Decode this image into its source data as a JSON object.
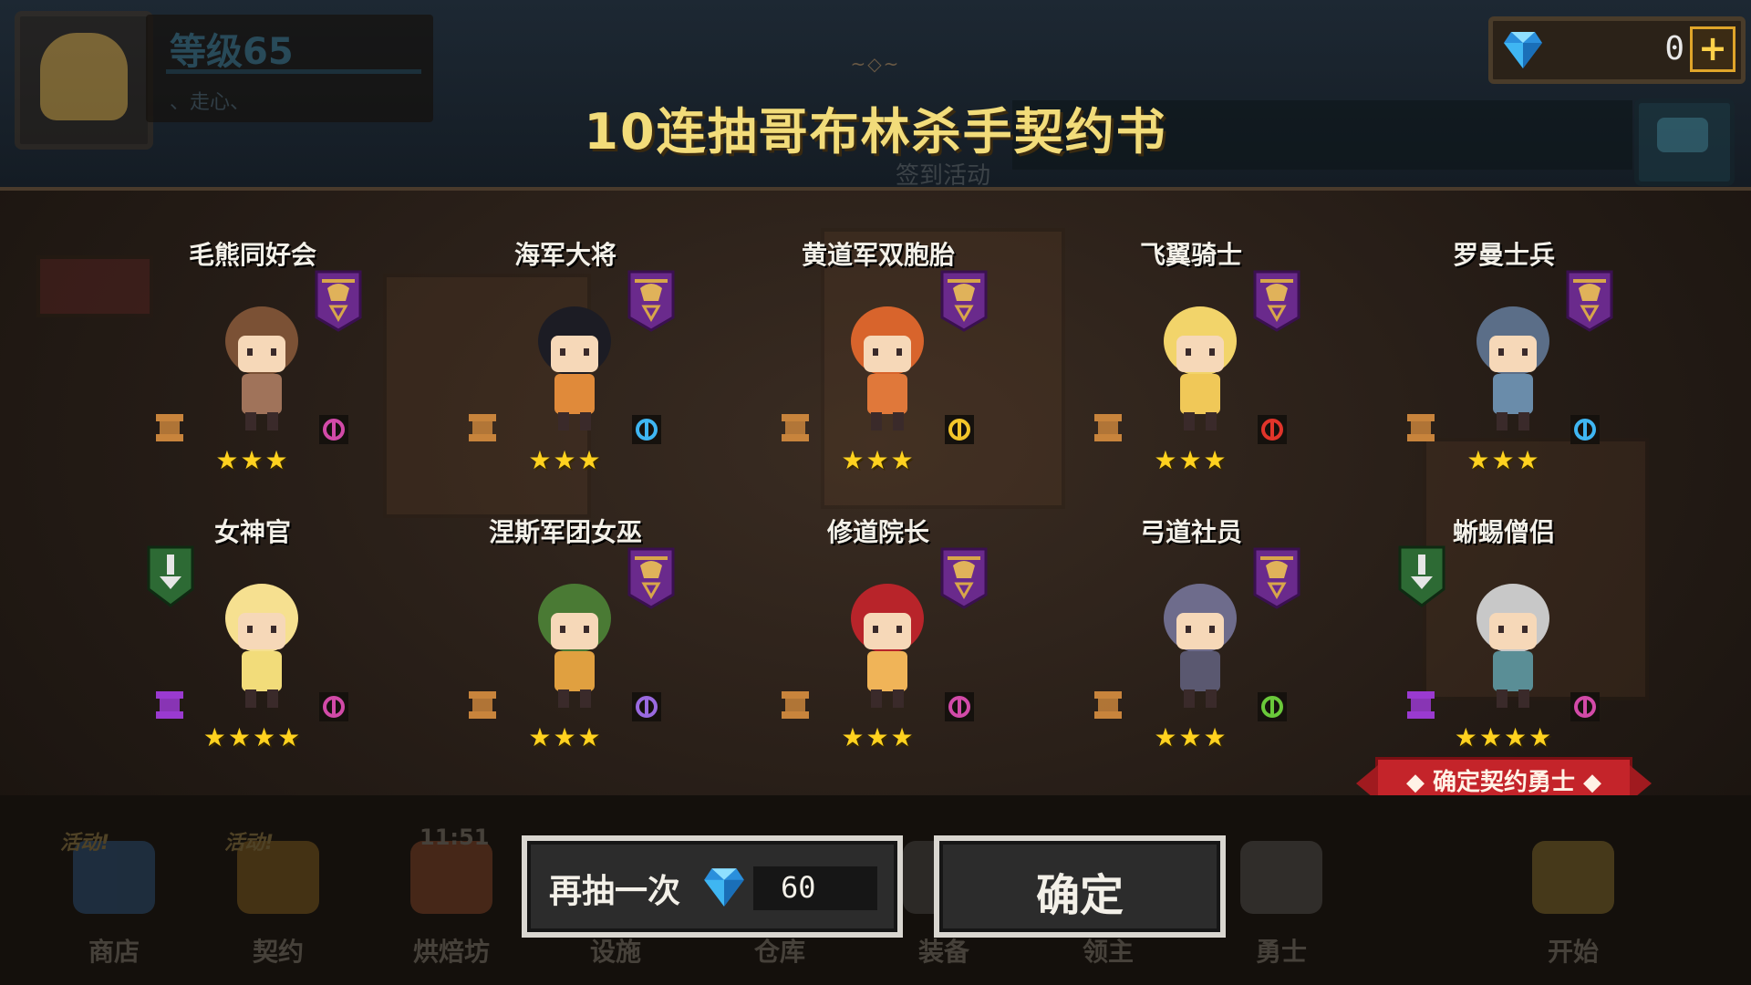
{
  "header": {
    "level": "等级65",
    "level_sub": "、走心、",
    "gems": "0",
    "plus": "+",
    "title_deco": "~◇~",
    "title": "10连抽哥布林杀手契约书",
    "event_ghost": "签到活动"
  },
  "cards": [
    {
      "name": "毛熊同好会",
      "stars": "★★★",
      "rarity": "bronze",
      "class_icon": "cleric-icon",
      "char_color": "#a0735a",
      "hair": "#7b5135"
    },
    {
      "name": "海军大将",
      "stars": "★★★",
      "rarity": "bronze",
      "class_icon": "gem-class-icon",
      "char_color": "#e08a3a",
      "hair": "#1c1c24"
    },
    {
      "name": "黄道军双胞胎",
      "stars": "★★★",
      "rarity": "bronze",
      "class_icon": "sword-icon",
      "char_color": "#e0783a",
      "hair": "#d8642c"
    },
    {
      "name": "飞翼骑士",
      "stars": "★★★",
      "rarity": "bronze",
      "class_icon": "crossed-swords-icon",
      "char_color": "#f0c858",
      "hair": "#f2d46a"
    },
    {
      "name": "罗曼士兵",
      "stars": "★★★",
      "rarity": "bronze",
      "class_icon": "gem-class-icon",
      "char_color": "#6a8caa",
      "hair": "#5b6e88"
    },
    {
      "name": "女神官",
      "stars": "★★★★",
      "rarity": "purple",
      "class_icon": "cleric-icon",
      "char_color": "#f2dc7a",
      "hair": "#f6e090"
    },
    {
      "name": "涅斯军团女巫",
      "stars": "★★★",
      "rarity": "bronze",
      "class_icon": "staff-icon",
      "char_color": "#e0a040",
      "hair": "#4a7a34"
    },
    {
      "name": "修道院长",
      "stars": "★★★",
      "rarity": "bronze",
      "class_icon": "cleric-icon",
      "char_color": "#f0b458",
      "hair": "#b8242a"
    },
    {
      "name": "弓道社员",
      "stars": "★★★",
      "rarity": "bronze",
      "class_icon": "crosshair-icon",
      "char_color": "#5a5870",
      "hair": "#6e6c8c"
    },
    {
      "name": "蜥蜴僧侣",
      "stars": "★★★★",
      "rarity": "purple",
      "class_icon": "cleric-icon",
      "char_color": "#5a8e96",
      "hair": "#c8c8c8"
    }
  ],
  "confirm_tag": "◆ 确定契约勇士 ◆",
  "nav": [
    {
      "label": "商店",
      "badge": "活动!"
    },
    {
      "label": "契约",
      "badge": "活动!"
    },
    {
      "label": "烘焙坊",
      "badge": "11:51"
    },
    {
      "label": "设施",
      "badge": ""
    },
    {
      "label": "仓库",
      "badge": ""
    },
    {
      "label": "装备",
      "badge": ""
    },
    {
      "label": "领主",
      "badge": ""
    },
    {
      "label": "勇士",
      "badge": ""
    },
    {
      "label": "开始",
      "badge": ""
    }
  ],
  "actions": {
    "redraw_label": "再抽一次",
    "redraw_cost": "60",
    "ok_label": "确定"
  },
  "colors": {
    "title": "#f2dc7a",
    "star": "#ffd21f",
    "banner_purple": "#6a2a8c",
    "confirm_red": "#c4242a",
    "gem_blue": "#3fb6f2"
  }
}
